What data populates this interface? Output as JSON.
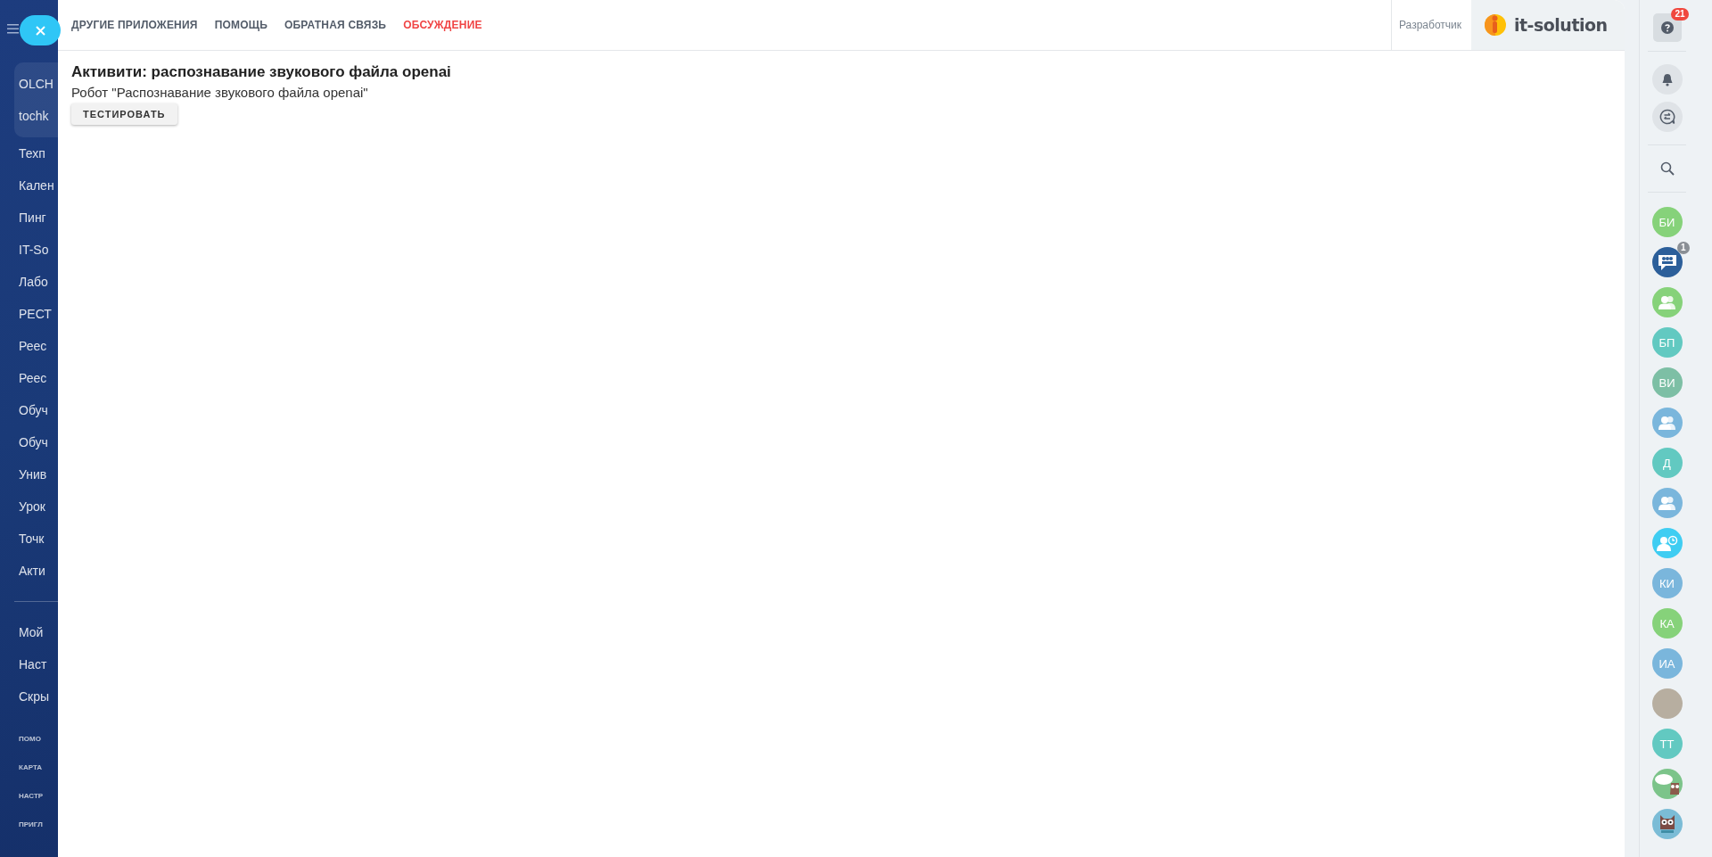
{
  "left_nav": {
    "group_items": [
      "OLCH",
      "tochk"
    ],
    "items": [
      "Техп",
      "Кален",
      "Пинг",
      "IT-So",
      "Лабо",
      "РЕСТ",
      "Реес",
      "Реес",
      "Обуч",
      "Обуч",
      "Унив",
      "Урок",
      "Точк",
      "Акти"
    ],
    "secondary_items": [
      "Мой",
      "Наст",
      "Скры"
    ],
    "footer_links": [
      "ПОМО",
      "КАРТА",
      "НАСТР",
      "ПРИГЛ"
    ]
  },
  "top_bar": {
    "tabs": [
      {
        "label": "ДРУГИЕ ПРИЛОЖЕНИЯ",
        "highlighted": false
      },
      {
        "label": "ПОМОЩЬ",
        "highlighted": false
      },
      {
        "label": "ОБРАТНАЯ СВЯЗЬ",
        "highlighted": false
      },
      {
        "label": "ОБСУЖДЕНИЕ",
        "highlighted": true
      }
    ],
    "user_label": "Разработчик",
    "logo_text": "it-solution"
  },
  "page": {
    "title": "Активити: распознавание звукового файла openai",
    "subtitle": "Робот \"Распознавание звукового файла openai\"",
    "button": "ТЕСТИРОВАТЬ"
  },
  "right_bar": {
    "help_badge": "21",
    "contacts": [
      {
        "kind": "initials",
        "text": "БИ",
        "color": "#86d27a"
      },
      {
        "kind": "group-chat",
        "color": "#2c5f9a",
        "badge": "1"
      },
      {
        "kind": "group",
        "color": "#86d27a"
      },
      {
        "kind": "initials",
        "text": "БП",
        "color": "#62c9c1"
      },
      {
        "kind": "initials",
        "text": "ВИ",
        "color": "#7dbfa5"
      },
      {
        "kind": "group",
        "color": "#7ab6dc"
      },
      {
        "kind": "initials",
        "text": "Д",
        "color": "#62c9c1"
      },
      {
        "kind": "group",
        "color": "#7ab6dc"
      },
      {
        "kind": "user-clock",
        "color": "#3fcdf2"
      },
      {
        "kind": "initials",
        "text": "КИ",
        "color": "#7ab6dc"
      },
      {
        "kind": "initials",
        "text": "КА",
        "color": "#86d27a"
      },
      {
        "kind": "initials",
        "text": "ИА",
        "color": "#7ab6dc"
      },
      {
        "kind": "photo",
        "color": "#b7aea0"
      },
      {
        "kind": "initials",
        "text": "ТТ",
        "color": "#62c9c1"
      },
      {
        "kind": "owl-chat",
        "color": "#7cc48a"
      },
      {
        "kind": "owl",
        "color": "#7bbcd6"
      }
    ]
  }
}
